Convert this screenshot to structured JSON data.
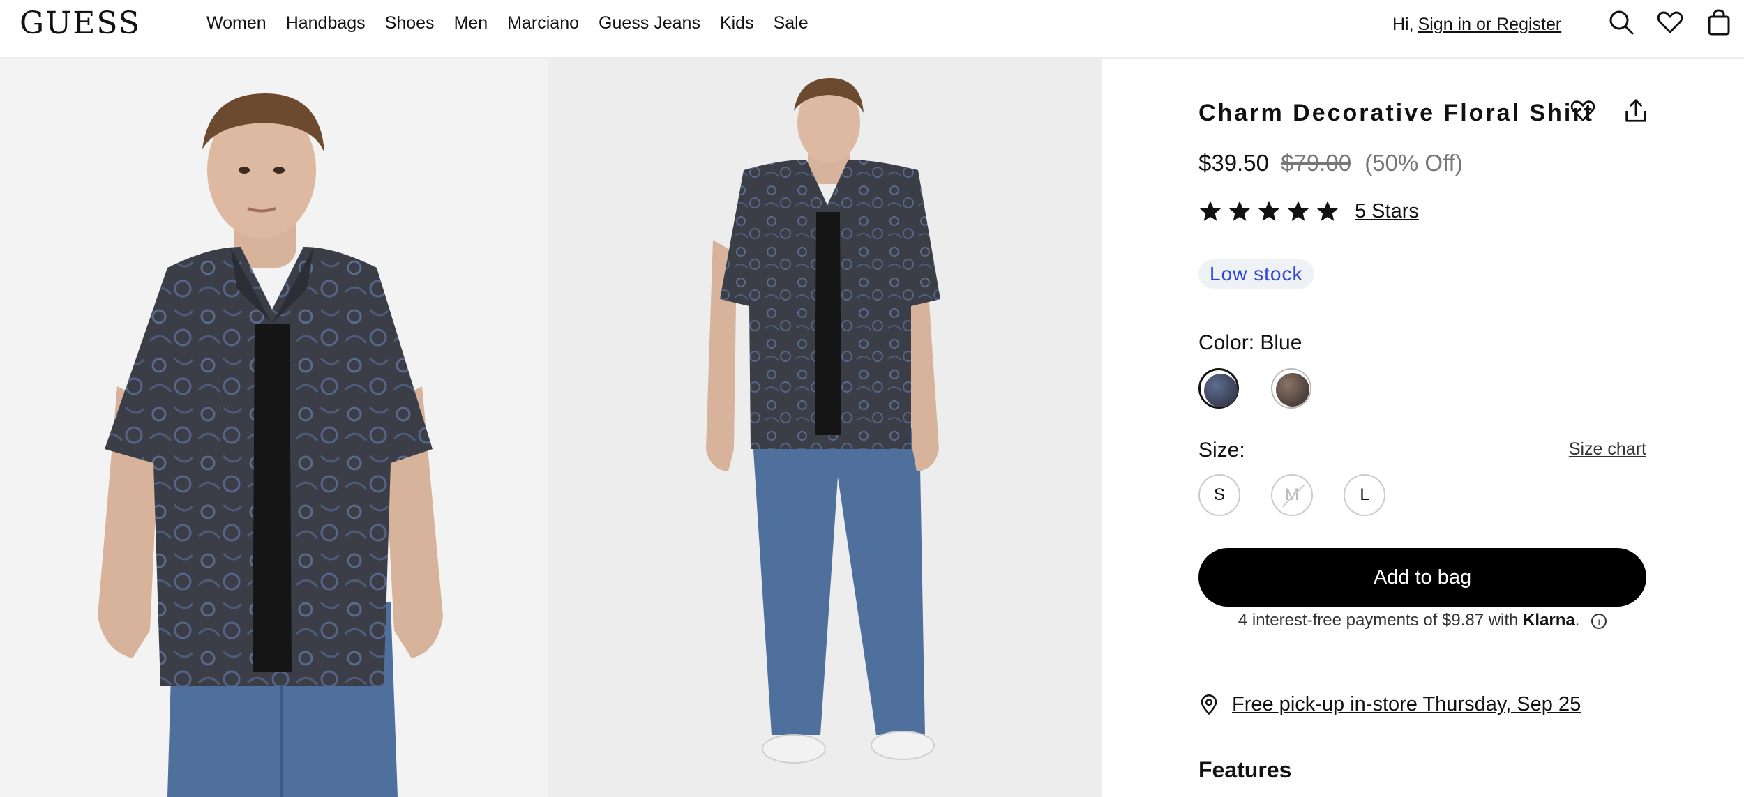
{
  "brand": {
    "logo": "GUESS"
  },
  "nav": {
    "items": [
      "Women",
      "Handbags",
      "Shoes",
      "Men",
      "Marciano",
      "Guess Jeans",
      "Kids",
      "Sale"
    ]
  },
  "account": {
    "greeting": "Hi,",
    "signin_label": "Sign in or Register"
  },
  "header_icons": [
    "search-icon",
    "heart-icon",
    "shopping-bag-icon"
  ],
  "product": {
    "title": "Charm Decorative Floral Shirt",
    "price_sale": "$39.50",
    "price_original": "$79.00",
    "discount": "(50% Off)",
    "rating": {
      "stars": 5,
      "label": "5 Stars"
    },
    "stock_badge": "Low stock",
    "color": {
      "label": "Color: Blue",
      "swatches": [
        {
          "name": "Blue",
          "selected": true
        },
        {
          "name": "Brown",
          "selected": false
        }
      ]
    },
    "size": {
      "label": "Size:",
      "chart_link": "Size chart",
      "options": [
        {
          "label": "S",
          "available": true
        },
        {
          "label": "M",
          "available": false
        },
        {
          "label": "L",
          "available": true
        }
      ]
    },
    "add_to_bag": "Add to bag",
    "klarna": {
      "text": "4 interest-free payments of $9.87 with",
      "brand": "Klarna",
      "suffix": "."
    },
    "pickup": "Free pick-up in-store Thursday, Sep 25",
    "features_heading": "Features"
  },
  "colors": {
    "accent_badge_text": "#2a46d8",
    "badge_bg": "#eef1f6",
    "button_bg": "#000000"
  }
}
